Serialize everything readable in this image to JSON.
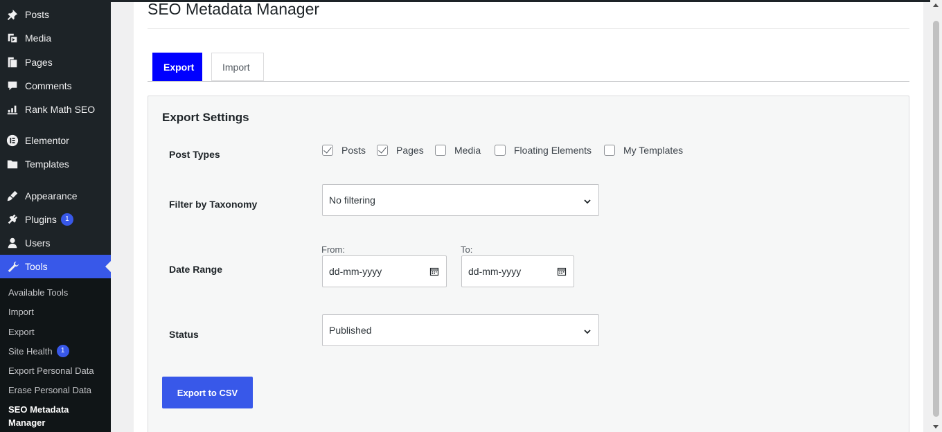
{
  "sidebar": {
    "items": [
      {
        "label": "Posts",
        "icon": "pin-icon"
      },
      {
        "label": "Media",
        "icon": "media-icon"
      },
      {
        "label": "Pages",
        "icon": "pages-icon"
      },
      {
        "label": "Comments",
        "icon": "comment-icon"
      },
      {
        "label": "Rank Math SEO",
        "icon": "chart-icon"
      },
      {
        "label": "Elementor",
        "icon": "elementor-icon"
      },
      {
        "label": "Templates",
        "icon": "folder-icon"
      },
      {
        "label": "Appearance",
        "icon": "brush-icon"
      },
      {
        "label": "Plugins",
        "icon": "plugin-icon",
        "badge": "1"
      },
      {
        "label": "Users",
        "icon": "user-icon"
      },
      {
        "label": "Tools",
        "icon": "wrench-icon"
      }
    ],
    "submenu": [
      {
        "label": "Available Tools"
      },
      {
        "label": "Import"
      },
      {
        "label": "Export"
      },
      {
        "label": "Site Health",
        "badge": "1"
      },
      {
        "label": "Export Personal Data"
      },
      {
        "label": "Erase Personal Data"
      },
      {
        "label": "SEO Metadata Manager"
      }
    ]
  },
  "page": {
    "title": "SEO Metadata Manager",
    "tabs": [
      {
        "label": "Export"
      },
      {
        "label": "Import"
      }
    ],
    "panel_title": "Export Settings",
    "post_types": {
      "label": "Post Types",
      "options": [
        {
          "label": "Posts",
          "checked": true
        },
        {
          "label": "Pages",
          "checked": true
        },
        {
          "label": "Media",
          "checked": false
        },
        {
          "label": "Floating Elements",
          "checked": false
        },
        {
          "label": "My Templates",
          "checked": false
        }
      ]
    },
    "taxonomy": {
      "label": "Filter by Taxonomy",
      "value": "No filtering"
    },
    "date_range": {
      "label": "Date Range",
      "from_label": "From:",
      "to_label": "To:",
      "from_placeholder": "dd-mm-yyyy",
      "to_placeholder": "dd-mm-yyyy"
    },
    "status": {
      "label": "Status",
      "value": "Published"
    },
    "export_button": "Export to CSV"
  },
  "colors": {
    "accent": "#3858e9",
    "tab_active": "#0000ff",
    "sidebar": "#1d2327"
  }
}
